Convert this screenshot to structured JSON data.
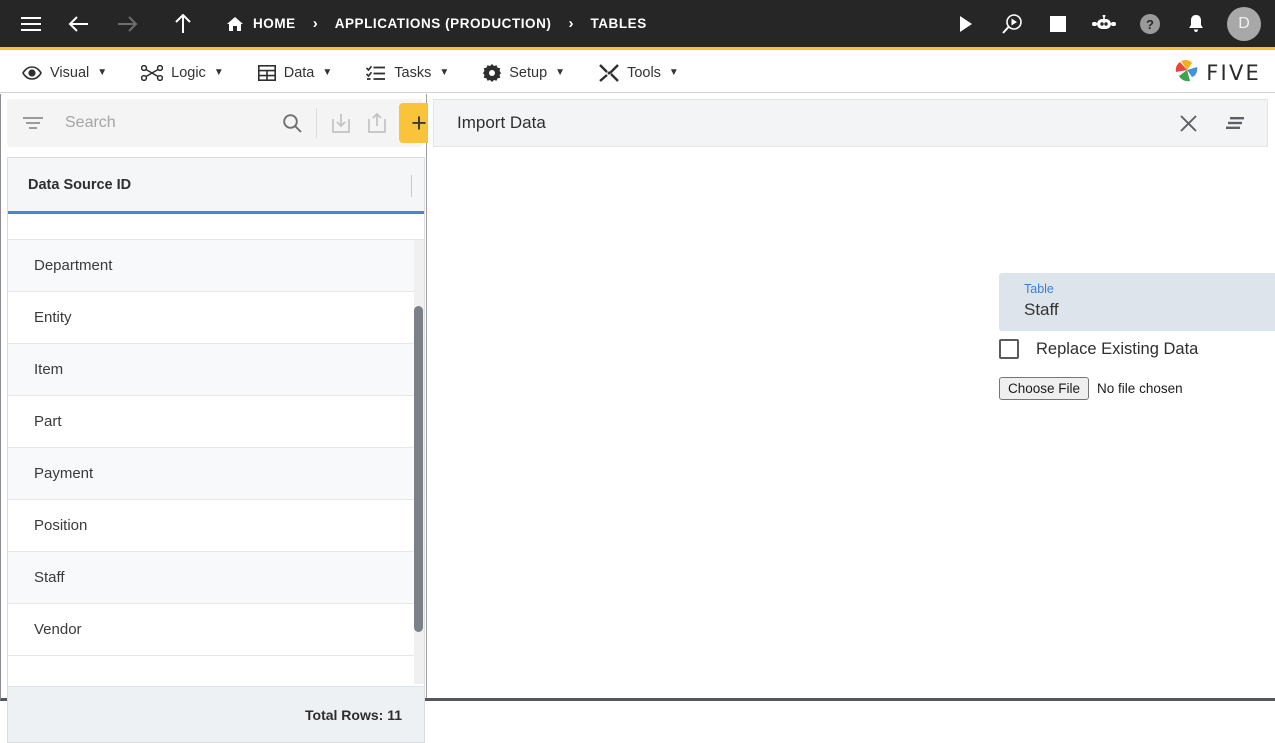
{
  "topbar": {
    "menu_icon": "hamburger-icon",
    "back_icon": "arrow-left-icon",
    "forward_icon": "arrow-right-icon",
    "up_icon": "arrow-up-icon",
    "breadcrumbs": [
      {
        "label": "HOME",
        "icon": "home-icon"
      },
      {
        "label": "APPLICATIONS (PRODUCTION)",
        "icon": ""
      },
      {
        "label": "TABLES",
        "icon": ""
      }
    ],
    "separator": "›",
    "actions": [
      {
        "name": "run-icon"
      },
      {
        "name": "debug-icon"
      },
      {
        "name": "stop-icon"
      },
      {
        "name": "bot-icon"
      },
      {
        "name": "help-icon"
      },
      {
        "name": "notifications-icon"
      }
    ],
    "avatar_initial": "D",
    "accent_color": "#f6c133",
    "background_color": "#262626"
  },
  "menubar": {
    "items": [
      {
        "label": "Visual",
        "icon": "eye-icon",
        "caret": "▼"
      },
      {
        "label": "Logic",
        "icon": "logic-nodes-icon",
        "caret": "▼"
      },
      {
        "label": "Data",
        "icon": "table-grid-icon",
        "caret": "▼"
      },
      {
        "label": "Tasks",
        "icon": "checklist-icon",
        "caret": "▼"
      },
      {
        "label": "Setup",
        "icon": "gear-icon",
        "caret": "▼"
      },
      {
        "label": "Tools",
        "icon": "wrench-screwdriver-icon",
        "caret": "▼"
      }
    ],
    "brand": "FIVE"
  },
  "left_panel": {
    "search": {
      "placeholder": "Search",
      "value": "",
      "filter_icon": "filter-icon",
      "search_icon": "search-icon",
      "import_icon": "import-icon",
      "export_icon": "export-icon",
      "add_label": "+",
      "add_color": "#f9c43a"
    },
    "grid": {
      "column_header": "Data Source ID",
      "header_underline_color": "#4187d5",
      "rows": [
        {
          "label": "Department"
        },
        {
          "label": "Entity"
        },
        {
          "label": "Item"
        },
        {
          "label": "Part"
        },
        {
          "label": "Payment"
        },
        {
          "label": "Position"
        },
        {
          "label": "Staff"
        },
        {
          "label": "Vendor"
        }
      ],
      "footer_total": "Total Rows: 11"
    }
  },
  "right_panel": {
    "title": "Import Data",
    "close_icon": "close-icon",
    "menu_icon": "list-menu-icon",
    "form": {
      "table_field": {
        "label": "Table",
        "value": "Staff",
        "caret": "dropdown-caret-icon",
        "background_color": "#dde4ec",
        "label_color": "#3f7ed4"
      },
      "replace_checkbox": {
        "label": "Replace Existing Data",
        "checked": false
      },
      "file_input": {
        "button_label": "Choose File",
        "status": "No file chosen"
      }
    },
    "annotation": {
      "type": "arrow",
      "color": "#ee1c25",
      "points_to": "table-dropdown-caret"
    }
  }
}
